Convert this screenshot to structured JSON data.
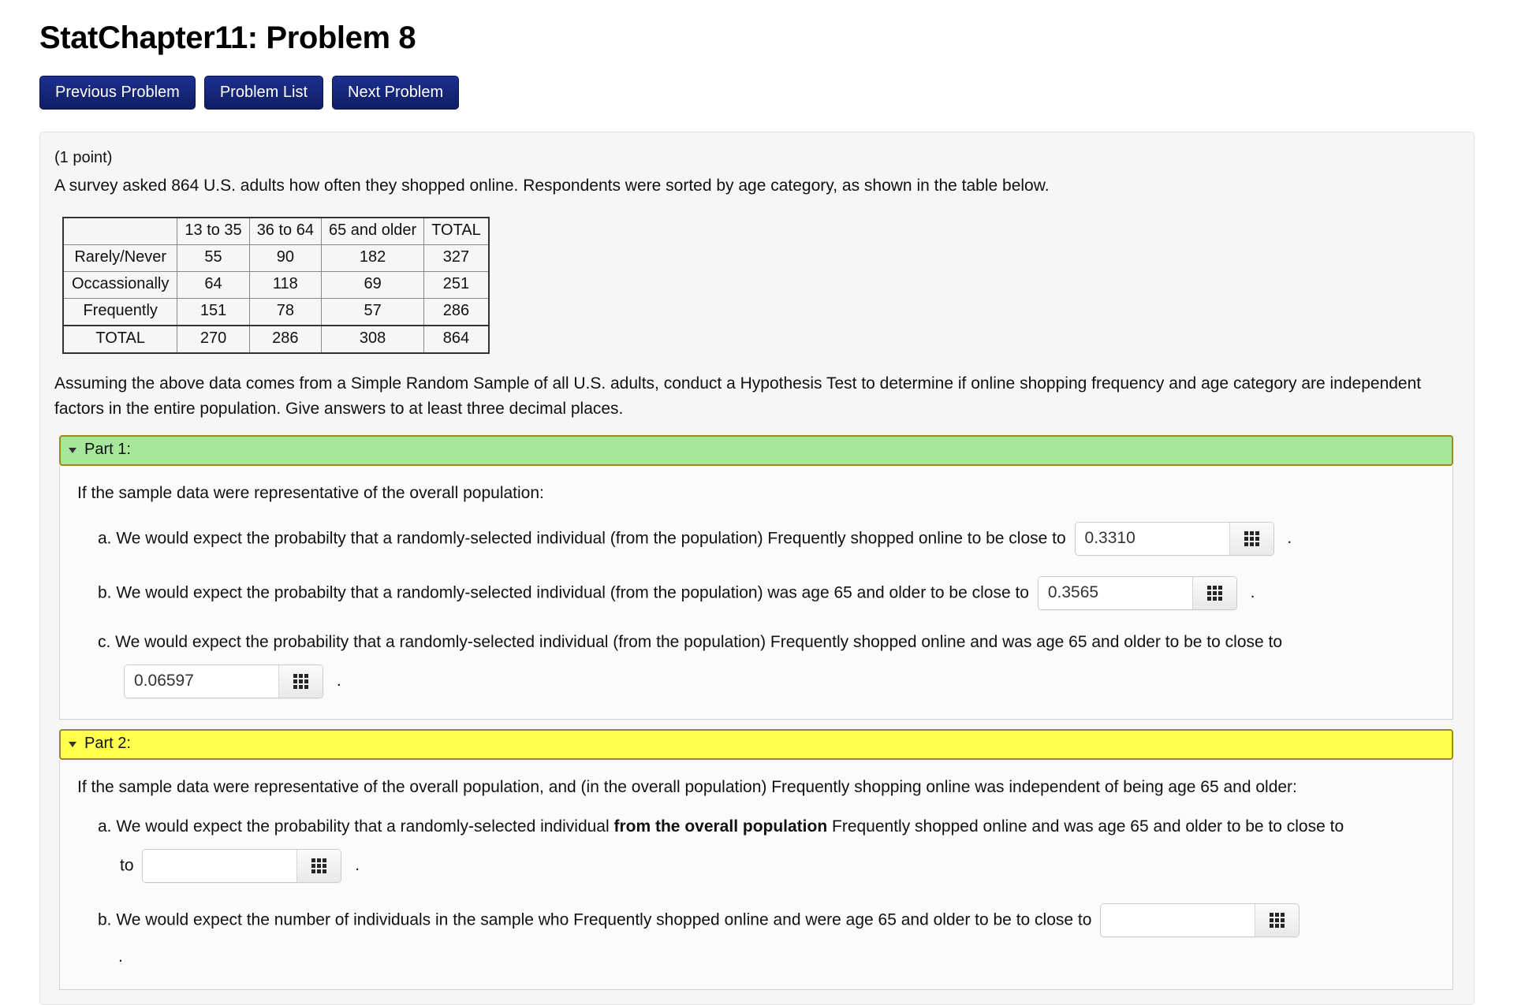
{
  "header": {
    "title": "StatChapter11: Problem 8",
    "nav": [
      {
        "label": "Previous Problem",
        "name": "previous-problem-button"
      },
      {
        "label": "Problem List",
        "name": "problem-list-button"
      },
      {
        "label": "Next Problem",
        "name": "next-problem-button"
      }
    ]
  },
  "problem": {
    "points": "(1 point)",
    "intro": "A survey asked 864 U.S. adults how often they shopped online. Respondents were sorted by age category, as shown in the table below.",
    "assumption": "Assuming the above data comes from a Simple Random Sample of all U.S. adults, conduct a Hypothesis Test to determine if online shopping frequency and age category are independent factors in the entire population. Give answers to at least three decimal places."
  },
  "chart_data": {
    "type": "table",
    "title": "Online shopping frequency by age category",
    "column_headers": [
      "",
      "13 to 35",
      "36 to 64",
      "65 and older",
      "TOTAL"
    ],
    "row_headers": [
      "Rarely/Never",
      "Occassionally",
      "Frequently",
      "TOTAL"
    ],
    "rows": [
      {
        "label": "Rarely/Never",
        "values": [
          "55",
          "90",
          "182",
          "327"
        ]
      },
      {
        "label": "Occassionally",
        "values": [
          "64",
          "118",
          "69",
          "251"
        ]
      },
      {
        "label": "Frequently",
        "values": [
          "151",
          "78",
          "57",
          "286"
        ]
      },
      {
        "label": "TOTAL",
        "values": [
          "270",
          "286",
          "308",
          "864"
        ]
      }
    ],
    "grand_total": 864
  },
  "part1": {
    "header_label": "Part 1:",
    "header_color": "#a6e79b",
    "lead": "If the sample data were representative of the overall population:",
    "a": {
      "prefix": "a. We would expect the probabilty that a randomly-selected individual (from the population) Frequently shopped online to be close to",
      "value": "0.3310",
      "suffix": "."
    },
    "b": {
      "prefix": "b. We would expect the probabilty that a randomly-selected individual (from the population) was age 65 and older to be close to",
      "value": "0.3565",
      "suffix": "."
    },
    "c": {
      "prefix": "c. We would expect the probability that a randomly-selected individual (from the population) Frequently shopped online and was age 65 and older to be to close to",
      "value": "0.06597",
      "suffix": "."
    }
  },
  "part2": {
    "header_label": "Part 2:",
    "header_color": "#ffff4d",
    "lead": "If the sample data were representative of the overall population, and (in the overall population) Frequently shopping online was independent of being age 65 and older:",
    "a": {
      "prefix_1": "a. We would expect the probability that a randomly-selected individual ",
      "bold": "from the overall population",
      "prefix_2": " Frequently shopped online and was age 65 and older to be to close to",
      "lead_in": "to",
      "value": "",
      "suffix": "."
    },
    "b": {
      "prefix": "b. We would expect the number of individuals in the sample who Frequently shopped online and were age 65 and older to be to close to",
      "value": "",
      "suffix": "."
    }
  },
  "icons": {
    "calculator": "calculator-grid-icon",
    "disclosure": "triangle-down-icon"
  }
}
